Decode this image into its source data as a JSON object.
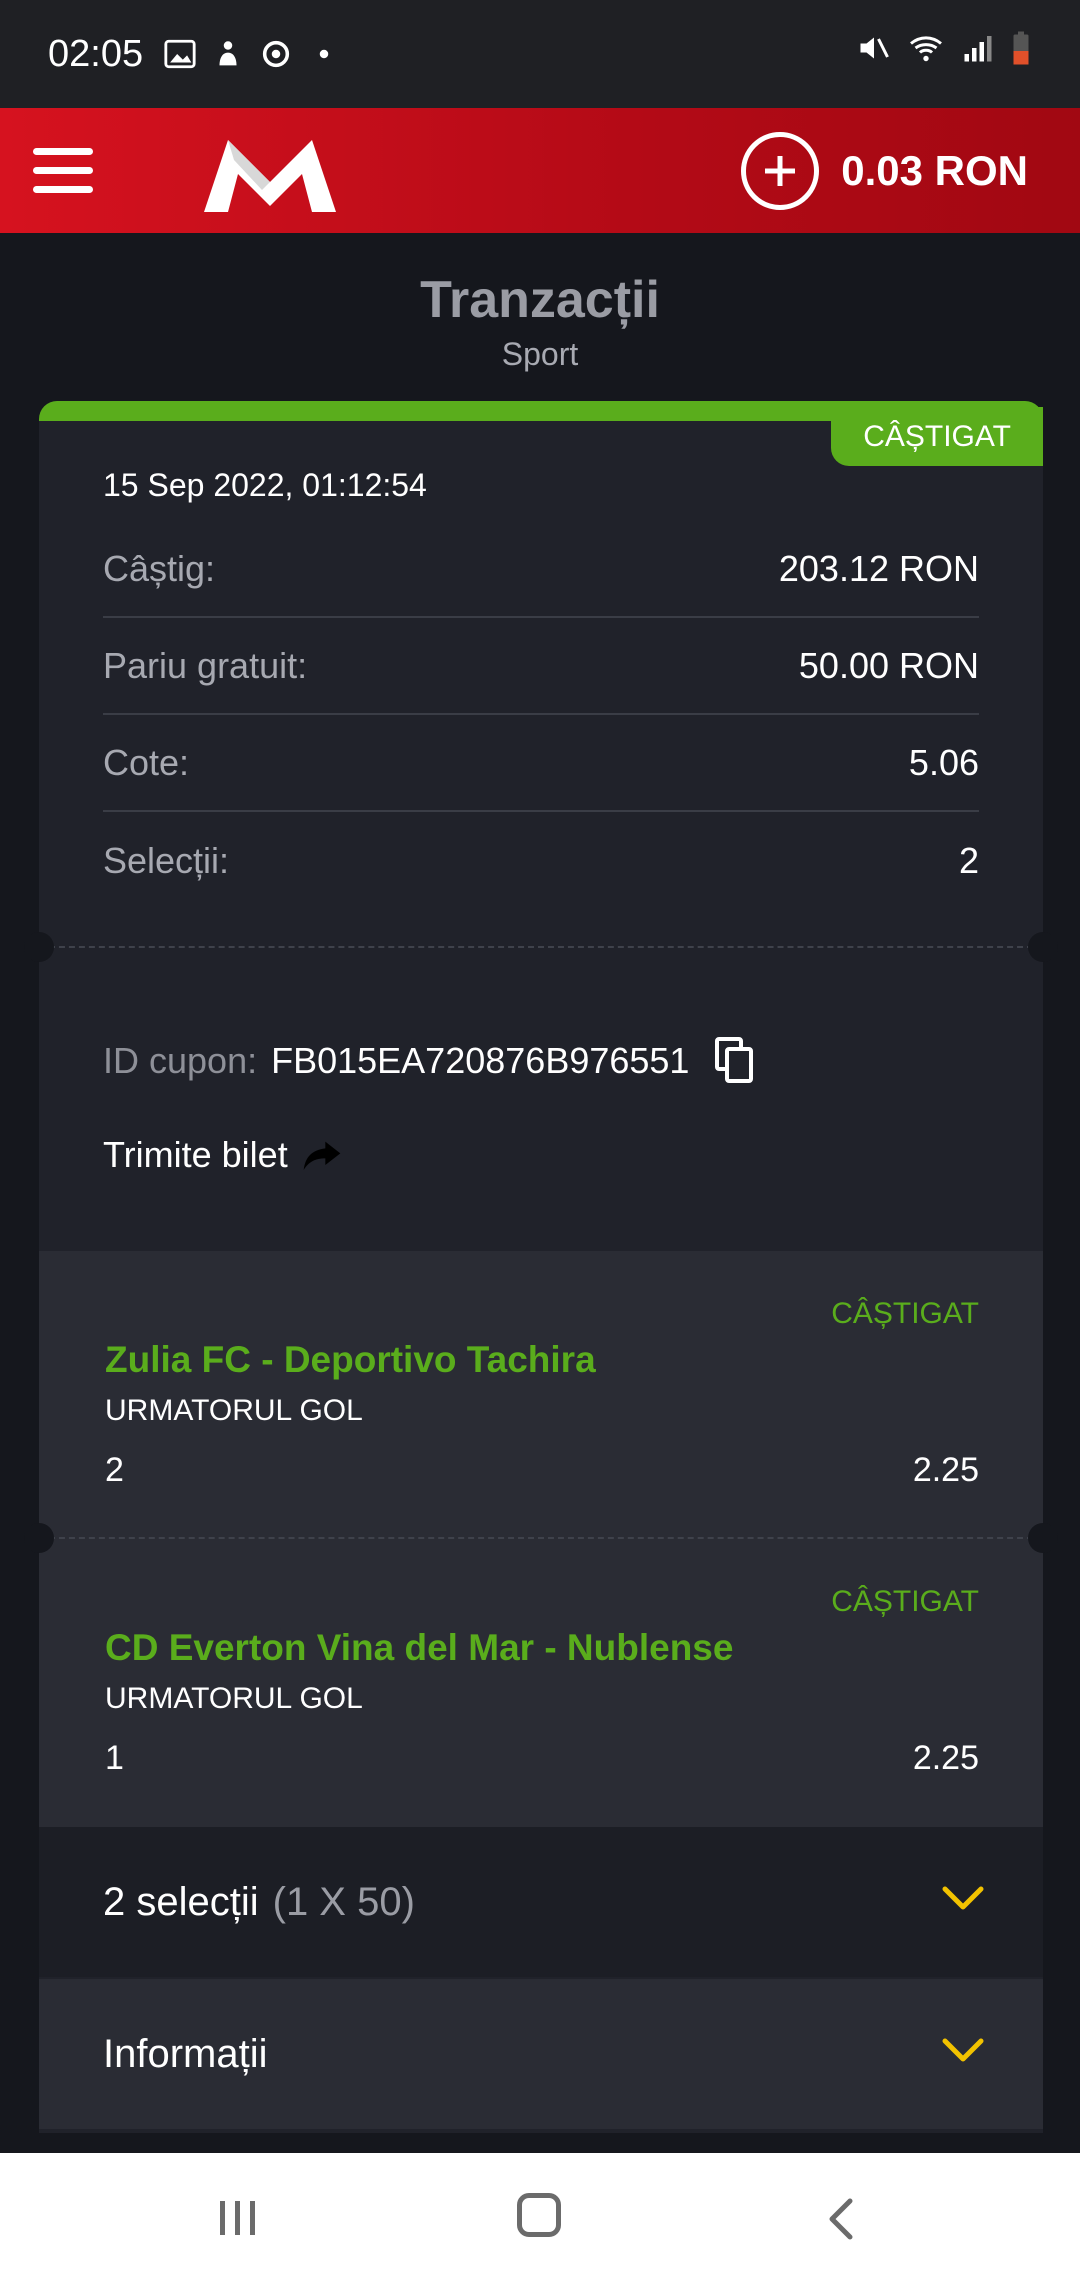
{
  "status_bar": {
    "time": "02:05"
  },
  "header": {
    "logo": "m-logo",
    "balance": "0.03 RON"
  },
  "page": {
    "title": "Tranzacții",
    "subtitle": "Sport"
  },
  "ticket": {
    "status": "CÂȘTIGAT",
    "timestamp": "15 Sep 2022, 01:12:54",
    "rows": [
      {
        "label": "Câștig:",
        "value": "203.12 RON"
      },
      {
        "label": "Pariu gratuit:",
        "value": "50.00 RON"
      },
      {
        "label": "Cote:",
        "value": "5.06"
      },
      {
        "label": "Selecții:",
        "value": "2"
      }
    ],
    "coupon_label": "ID cupon:",
    "coupon_id": "FB015EA720876B976551",
    "send_label": "Trimite bilet"
  },
  "selections": [
    {
      "status": "CÂȘTIGAT",
      "event": "Zulia FC - Deportivo Tachira",
      "market": "URMATORUL GOL",
      "pick": "2",
      "odds": "2.25"
    },
    {
      "status": "CÂȘTIGAT",
      "event": "CD Everton Vina del Mar - Nublense",
      "market": "URMATORUL GOL",
      "pick": "1",
      "odds": "2.25"
    }
  ],
  "accordions": {
    "selections_label": "2 selecții",
    "selections_detail": "(1 X 50)",
    "info_label": "Informații"
  },
  "colors": {
    "accent_green": "#5aad1c",
    "header_red": "#d6121f",
    "chevron_yellow": "#f2c200"
  }
}
